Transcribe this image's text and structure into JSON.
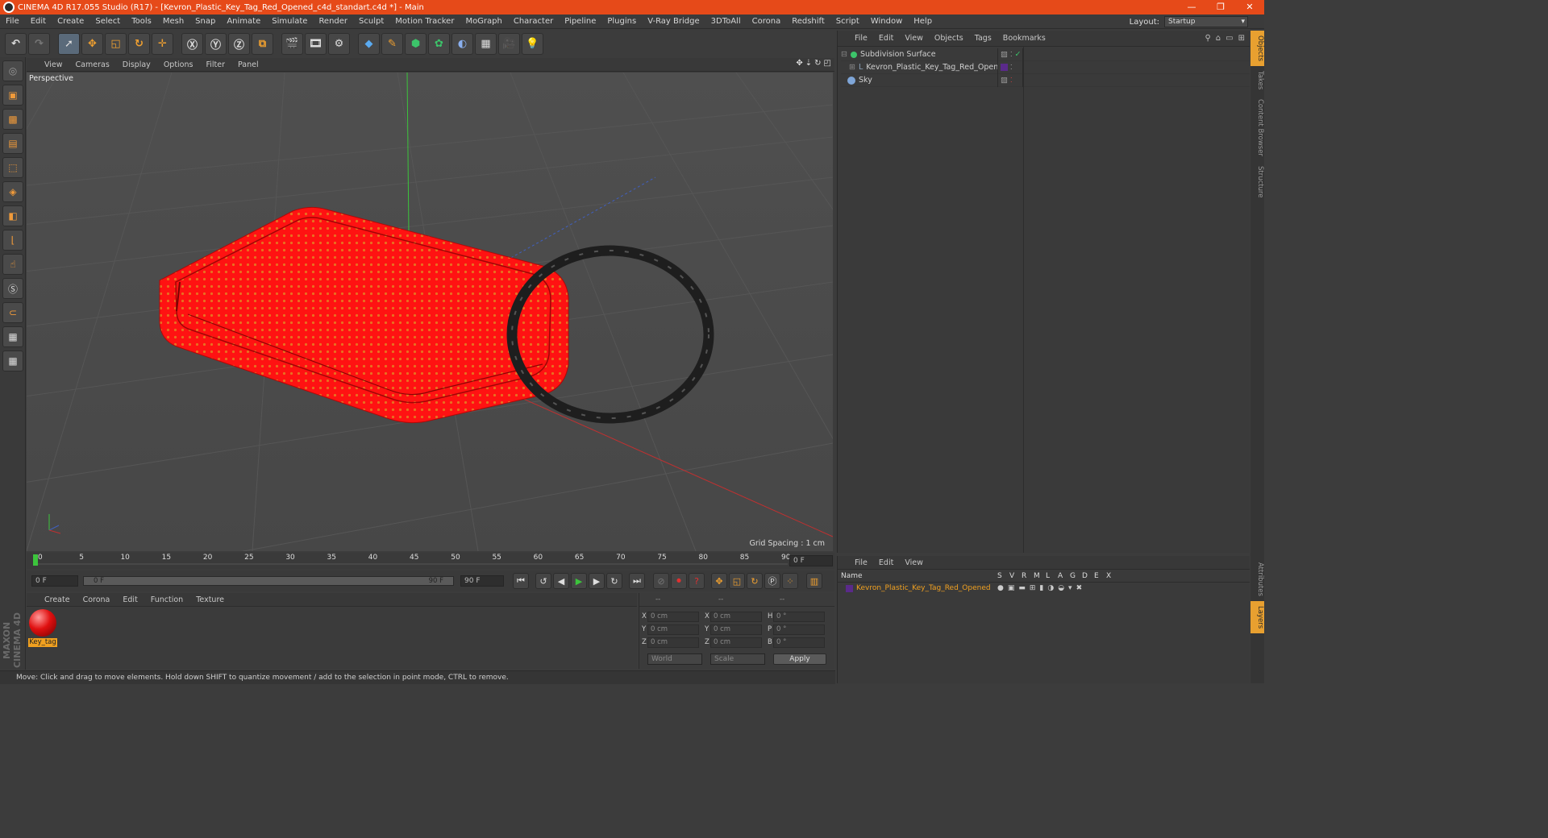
{
  "window": {
    "title": "CINEMA 4D R17.055 Studio (R17) - [Kevron_Plastic_Key_Tag_Red_Opened_c4d_standart.c4d *] - Main",
    "min": "—",
    "max": "❐",
    "close": "✕"
  },
  "menu": [
    "File",
    "Edit",
    "Create",
    "Select",
    "Tools",
    "Mesh",
    "Snap",
    "Animate",
    "Simulate",
    "Render",
    "Sculpt",
    "Motion Tracker",
    "MoGraph",
    "Character",
    "Pipeline",
    "Plugins",
    "V-Ray Bridge",
    "3DToAll",
    "Corona",
    "Redshift",
    "Script",
    "Window",
    "Help"
  ],
  "layout": {
    "label": "Layout:",
    "value": "Startup"
  },
  "viewport": {
    "menu": [
      "View",
      "Cameras",
      "Display",
      "Options",
      "Filter",
      "Panel"
    ],
    "camera": "Perspective",
    "grid_spacing": "Grid Spacing : 1 cm"
  },
  "timeline": {
    "ticks": [
      "0",
      "5",
      "10",
      "15",
      "20",
      "25",
      "30",
      "35",
      "40",
      "45",
      "50",
      "55",
      "60",
      "65",
      "70",
      "75",
      "80",
      "85",
      "90"
    ],
    "current_frame": "0 F",
    "start_field": "0 F",
    "range_start": "0 F",
    "range_end": "90 F",
    "end_field": "90 F"
  },
  "material_manager": {
    "menu": [
      "Create",
      "Corona",
      "Edit",
      "Function",
      "Texture"
    ],
    "materials": [
      {
        "name": "Key_tag"
      }
    ]
  },
  "coordinates": {
    "headers": [
      "--",
      "--",
      "--"
    ],
    "rows": [
      {
        "a": "X",
        "av": "0 cm",
        "b": "X",
        "bv": "0 cm",
        "c": "H",
        "cv": "0 °"
      },
      {
        "a": "Y",
        "av": "0 cm",
        "b": "Y",
        "bv": "0 cm",
        "c": "P",
        "cv": "0 °"
      },
      {
        "a": "Z",
        "av": "0 cm",
        "b": "Z",
        "bv": "0 cm",
        "c": "B",
        "cv": "0 °"
      }
    ],
    "space": "World",
    "mode": "Scale",
    "apply": "Apply"
  },
  "status": "Move: Click and drag to move elements. Hold down SHIFT to quantize movement / add to the selection in point mode, CTRL to remove.",
  "brand": "MAXON CINEMA 4D",
  "object_manager": {
    "menu": [
      "File",
      "Edit",
      "View",
      "Objects",
      "Tags",
      "Bookmarks"
    ],
    "objects": [
      {
        "name": "Subdivision Surface",
        "color": "#3cc46a"
      },
      {
        "name": "Kevron_Plastic_Key_Tag_Red_Opened",
        "color": "#8aa0b8"
      },
      {
        "name": "Sky",
        "color": "#7fa6d8"
      }
    ]
  },
  "side_tabs": [
    "Objects",
    "Takes",
    "Content Browser",
    "Structure"
  ],
  "side_tabs_lower": [
    "Attributes",
    "Layers"
  ],
  "layer_manager": {
    "menu": [
      "File",
      "Edit",
      "View"
    ],
    "columns": [
      "Name",
      "S",
      "V",
      "R",
      "M",
      "L",
      "A",
      "G",
      "D",
      "E",
      "X"
    ],
    "rows": [
      {
        "name": "Kevron_Plastic_Key_Tag_Red_Opened"
      }
    ]
  },
  "colors": {
    "accent": "#e64a19",
    "tag_red": "#ff1010",
    "ring": "#1e1e1e",
    "layer_name": "#f0a020"
  }
}
